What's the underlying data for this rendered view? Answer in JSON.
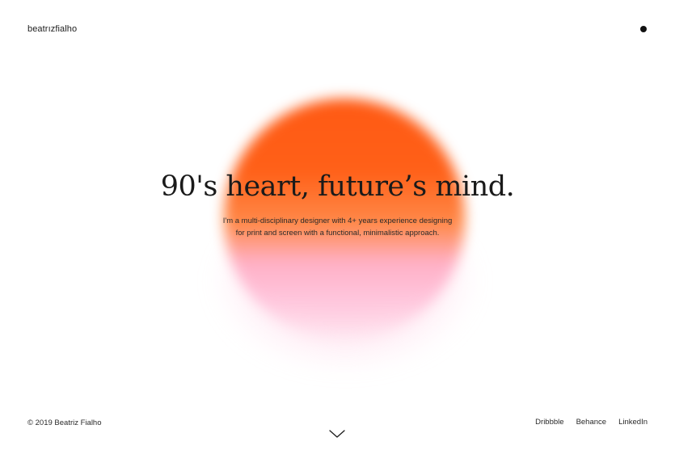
{
  "header": {
    "logo_text": "beatrızfialho",
    "menu_icon": "dot-menu-icon"
  },
  "hero": {
    "headline": "90's heart, future’s mind.",
    "subtext_line1": "I'm a multi-disciplinary designer with 4+ years experience designing",
    "subtext_line2": "for print and screen with a functional, minimalistic approach.",
    "orb_colors": {
      "top": "#ff5a14",
      "bottom": "#ffc3da"
    }
  },
  "footer": {
    "copyright": "© 2019 Beatriz Fialho",
    "links": [
      {
        "label": "Dribbble"
      },
      {
        "label": "Behance"
      },
      {
        "label": "LinkedIn"
      }
    ],
    "scroll_icon": "chevron-down-icon"
  }
}
